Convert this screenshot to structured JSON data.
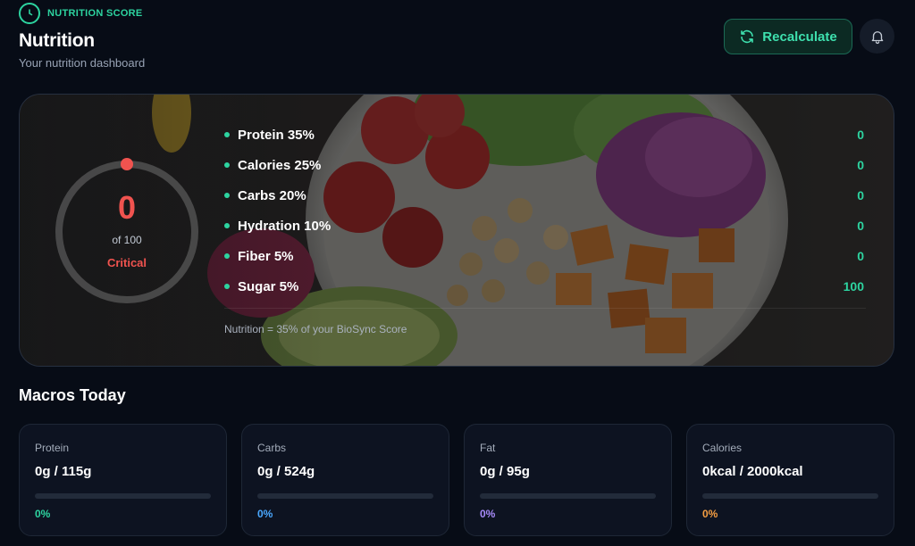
{
  "header": {
    "badge_label": "NUTRITION SCORE",
    "badge_icon": "clock-icon",
    "title": "Nutrition",
    "subtitle": "Your nutrition dashboard",
    "recalculate_label": "Recalculate",
    "recalculate_icon": "refresh-icon",
    "bell_icon": "bell-icon"
  },
  "score": {
    "value": "0",
    "max_label": "of 100",
    "status": "Critical",
    "progress": 0,
    "status_color": "#f0534f"
  },
  "factors": [
    {
      "label": "Protein 35%",
      "value": "0"
    },
    {
      "label": "Calories 25%",
      "value": "0"
    },
    {
      "label": "Carbs 20%",
      "value": "0"
    },
    {
      "label": "Hydration 10%",
      "value": "0"
    },
    {
      "label": "Fiber 5%",
      "value": "0"
    },
    {
      "label": "Sugar 5%",
      "value": "100"
    }
  ],
  "hero_footnote": "Nutrition = 35% of your BioSync Score",
  "macros": {
    "title": "Macros Today",
    "items": [
      {
        "label": "Protein",
        "value": "0g / 115g",
        "percent": "0%",
        "progress": 0,
        "color": "#2dd4a0"
      },
      {
        "label": "Carbs",
        "value": "0g / 524g",
        "percent": "0%",
        "progress": 0,
        "color": "#4aa8ff"
      },
      {
        "label": "Fat",
        "value": "0g / 95g",
        "percent": "0%",
        "progress": 0,
        "color": "#a78bfa"
      },
      {
        "label": "Calories",
        "value": "0kcal / 2000kcal",
        "percent": "0%",
        "progress": 0,
        "color": "#f59e42"
      }
    ]
  },
  "colors": {
    "accent": "#2dd4a0",
    "background": "#070c16",
    "card": "#0d1321",
    "critical": "#f0534f"
  }
}
